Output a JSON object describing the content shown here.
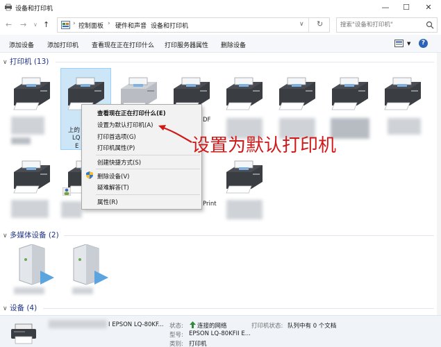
{
  "window": {
    "title": "设备和打印机"
  },
  "address": {
    "crumbs": [
      "控制面板",
      "硬件和声音",
      "设备和打印机"
    ],
    "search_placeholder": "搜索\"设备和打印机\""
  },
  "toolbar": {
    "commands": [
      "添加设备",
      "添加打印机",
      "查看现在正在打印什么",
      "打印服务器属性",
      "删除设备"
    ]
  },
  "groups": {
    "printers": "打印机 (13)",
    "multimedia": "多媒体设备 (2)",
    "devices": "设备 (4)"
  },
  "printer_labels": {
    "selected_line1": "上的",
    "selected_line2": "LQ",
    "selected_line3": "E",
    "side_pdf": "DF",
    "side_print": "Print"
  },
  "context_menu": {
    "items": [
      "查看现在正在打印什么(E)",
      "设置为默认打印机(A)",
      "打印首选项(G)",
      "打印机属性(P)",
      "创建快捷方式(S)",
      "删除设备(V)",
      "疑难解答(T)",
      "属性(R)"
    ]
  },
  "annotation": "设置为默认打印机",
  "details": {
    "name": "I EPSON LQ-80KF...",
    "status_key": "状态:",
    "status_val": "连接的网络",
    "printer_status_key": "打印机状态:",
    "printer_status_val": "队列中有 0 个文档",
    "model_key": "型号:",
    "model_val": "EPSON LQ-80KFII E...",
    "category_key": "类别:",
    "category_val": "打印机"
  },
  "colors": {
    "annotation": "#d01919",
    "selection": "#cde6f7",
    "group_header": "#1e3287"
  }
}
